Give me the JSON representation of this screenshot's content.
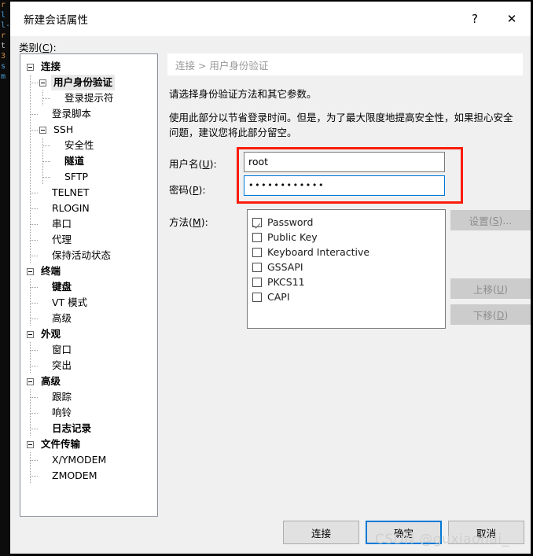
{
  "window": {
    "title": "新建会话属性",
    "help_label": "?",
    "close_label": "✕"
  },
  "category": {
    "label_prefix": "类别",
    "label_accel": "C",
    "label_suffix": ":"
  },
  "tree": {
    "items": [
      {
        "label": "连接",
        "depth": 0,
        "expander": true,
        "bold": true,
        "selected": false
      },
      {
        "label": "用户身份验证",
        "depth": 1,
        "expander": true,
        "bold": true,
        "selected": true
      },
      {
        "label": "登录提示符",
        "depth": 2,
        "expander": false,
        "bold": false,
        "selected": false
      },
      {
        "label": "登录脚本",
        "depth": 1,
        "expander": false,
        "bold": false,
        "selected": false
      },
      {
        "label": "SSH",
        "depth": 1,
        "expander": true,
        "bold": false,
        "selected": false
      },
      {
        "label": "安全性",
        "depth": 2,
        "expander": false,
        "bold": false,
        "selected": false
      },
      {
        "label": "隧道",
        "depth": 2,
        "expander": false,
        "bold": true,
        "selected": false
      },
      {
        "label": "SFTP",
        "depth": 2,
        "expander": false,
        "bold": false,
        "selected": false
      },
      {
        "label": "TELNET",
        "depth": 1,
        "expander": false,
        "bold": false,
        "selected": false
      },
      {
        "label": "RLOGIN",
        "depth": 1,
        "expander": false,
        "bold": false,
        "selected": false
      },
      {
        "label": "串口",
        "depth": 1,
        "expander": false,
        "bold": false,
        "selected": false
      },
      {
        "label": "代理",
        "depth": 1,
        "expander": false,
        "bold": false,
        "selected": false
      },
      {
        "label": "保持活动状态",
        "depth": 1,
        "expander": false,
        "bold": false,
        "selected": false
      },
      {
        "label": "终端",
        "depth": 0,
        "expander": true,
        "bold": true,
        "selected": false
      },
      {
        "label": "键盘",
        "depth": 1,
        "expander": false,
        "bold": true,
        "selected": false
      },
      {
        "label": "VT 模式",
        "depth": 1,
        "expander": false,
        "bold": false,
        "selected": false
      },
      {
        "label": "高级",
        "depth": 1,
        "expander": false,
        "bold": false,
        "selected": false
      },
      {
        "label": "外观",
        "depth": 0,
        "expander": true,
        "bold": true,
        "selected": false
      },
      {
        "label": "窗口",
        "depth": 1,
        "expander": false,
        "bold": false,
        "selected": false
      },
      {
        "label": "突出",
        "depth": 1,
        "expander": false,
        "bold": false,
        "selected": false
      },
      {
        "label": "高级",
        "depth": 0,
        "expander": true,
        "bold": true,
        "selected": false
      },
      {
        "label": "跟踪",
        "depth": 1,
        "expander": false,
        "bold": false,
        "selected": false
      },
      {
        "label": "响铃",
        "depth": 1,
        "expander": false,
        "bold": false,
        "selected": false
      },
      {
        "label": "日志记录",
        "depth": 1,
        "expander": false,
        "bold": true,
        "selected": false
      },
      {
        "label": "文件传输",
        "depth": 0,
        "expander": true,
        "bold": true,
        "selected": false
      },
      {
        "label": "X/YMODEM",
        "depth": 1,
        "expander": false,
        "bold": false,
        "selected": false
      },
      {
        "label": "ZMODEM",
        "depth": 1,
        "expander": false,
        "bold": false,
        "selected": false
      }
    ]
  },
  "breadcrumb": {
    "text": "连接 > 用户身份验证"
  },
  "description": {
    "line1": "请选择身份验证方法和其它参数。",
    "line2": "使用此部分以节省登录时间。但是，为了最大限度地提高安全性，如果担心安全问题，建议您将此部分留空。"
  },
  "form": {
    "username": {
      "label_prefix": "用户名",
      "label_accel": "U",
      "label_suffix": ":",
      "value": "root",
      "placeholder": ""
    },
    "password": {
      "label_prefix": "密码",
      "label_accel": "P",
      "label_suffix": ":",
      "value": "••••••••••••",
      "placeholder": ""
    },
    "highlight_color": "#fb1c09",
    "focus_color": "#0078d7"
  },
  "methods": {
    "label_prefix": "方法",
    "label_accel": "M",
    "label_suffix": ":",
    "items": [
      {
        "label": "Password",
        "checked": true
      },
      {
        "label": "Public Key",
        "checked": false
      },
      {
        "label": "Keyboard Interactive",
        "checked": false
      },
      {
        "label": "GSSAPI",
        "checked": false
      },
      {
        "label": "PKCS11",
        "checked": false
      },
      {
        "label": "CAPI",
        "checked": false
      }
    ],
    "buttons": [
      {
        "name": "settings",
        "prefix": "设置",
        "accel": "S",
        "suffix": "...",
        "enabled": false
      },
      {
        "name": "move-up",
        "prefix": "上移",
        "accel": "U",
        "suffix": "",
        "enabled": false
      },
      {
        "name": "move-down",
        "prefix": "下移",
        "accel": "D",
        "suffix": "",
        "enabled": false
      }
    ]
  },
  "footer": {
    "connect": "连接",
    "ok": "确定",
    "cancel": "取消"
  },
  "watermark": {
    "text": "CSDN @guxiaohai_"
  },
  "terminal": {
    "lines": [
      "r",
      "l",
      "",
      "",
      "",
      "",
      "",
      "",
      "",
      "l-",
      "r",
      "",
      "t",
      "3",
      "s",
      "",
      "m"
    ]
  }
}
